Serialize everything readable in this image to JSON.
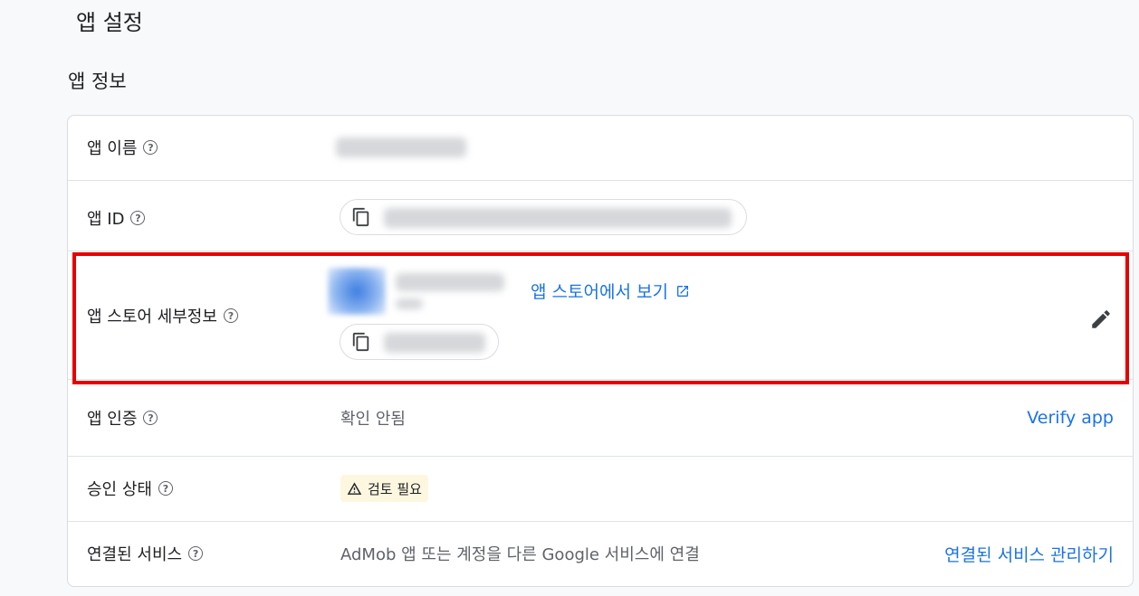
{
  "page": {
    "title": "앱 설정",
    "section_title": "앱 정보"
  },
  "rows": {
    "app_name": {
      "label": "앱 이름"
    },
    "app_id": {
      "label": "앱 ID"
    },
    "store_details": {
      "label": "앱 스토어 세부정보",
      "store_link_label": "앱 스토어에서 보기"
    },
    "verification": {
      "label": "앱 인증",
      "value": "확인 안됨",
      "action_label": "Verify app"
    },
    "approval": {
      "label": "승인 상태",
      "badge_label": "검토 필요",
      "badge_color": "#fef7e0"
    },
    "linked_services": {
      "label": "연결된 서비스",
      "value": "AdMob 앱 또는 계정을 다른 Google 서비스에 연결",
      "action_label": "연결된 서비스 관리하기"
    }
  },
  "icons": {
    "help": "help-circle-icon",
    "copy": "copy-icon",
    "external": "external-link-icon",
    "edit": "pencil-icon",
    "warning": "warning-triangle-icon"
  },
  "colors": {
    "link": "#1a73e8",
    "highlight": "#e60000",
    "border": "#dadce0"
  }
}
